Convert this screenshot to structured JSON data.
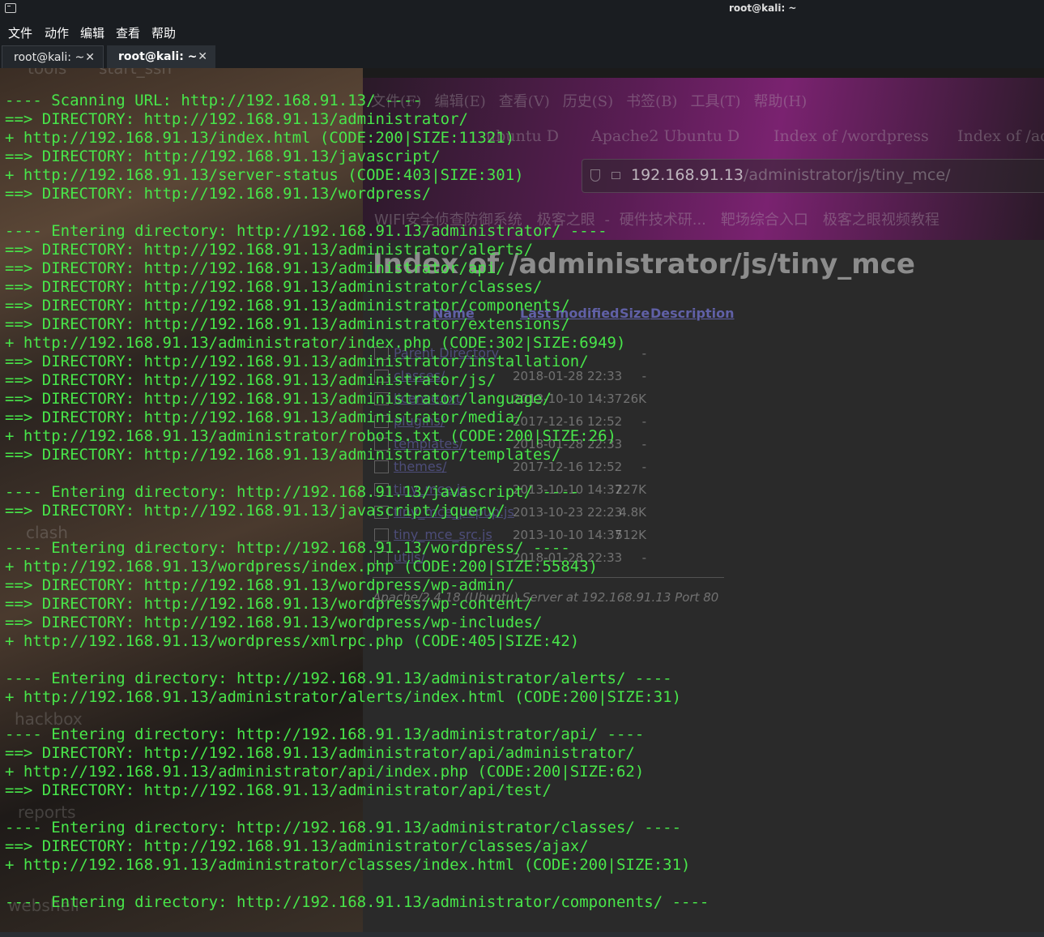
{
  "window": {
    "title": "root@kali: ~"
  },
  "menubar": [
    "文件",
    "动作",
    "编辑",
    "查看",
    "帮助"
  ],
  "tabs": [
    {
      "label": "root@kali: ~",
      "active": false
    },
    {
      "label": "root@kali: ~",
      "active": true
    }
  ],
  "tab_close_glyph": "✕",
  "terminal_lines": [
    "---- Scanning URL: http://192.168.91.13/ ----",
    "==> DIRECTORY: http://192.168.91.13/administrator/",
    "+ http://192.168.91.13/index.html (CODE:200|SIZE:11321)",
    "==> DIRECTORY: http://192.168.91.13/javascript/",
    "+ http://192.168.91.13/server-status (CODE:403|SIZE:301)",
    "==> DIRECTORY: http://192.168.91.13/wordpress/",
    "",
    "---- Entering directory: http://192.168.91.13/administrator/ ----",
    "==> DIRECTORY: http://192.168.91.13/administrator/alerts/",
    "==> DIRECTORY: http://192.168.91.13/administrator/api/",
    "==> DIRECTORY: http://192.168.91.13/administrator/classes/",
    "==> DIRECTORY: http://192.168.91.13/administrator/components/",
    "==> DIRECTORY: http://192.168.91.13/administrator/extensions/",
    "+ http://192.168.91.13/administrator/index.php (CODE:302|SIZE:6949)",
    "==> DIRECTORY: http://192.168.91.13/administrator/installation/",
    "==> DIRECTORY: http://192.168.91.13/administrator/js/",
    "==> DIRECTORY: http://192.168.91.13/administrator/language/",
    "==> DIRECTORY: http://192.168.91.13/administrator/media/",
    "+ http://192.168.91.13/administrator/robots.txt (CODE:200|SIZE:26)",
    "==> DIRECTORY: http://192.168.91.13/administrator/templates/",
    "",
    "---- Entering directory: http://192.168.91.13/javascript/ ----",
    "==> DIRECTORY: http://192.168.91.13/javascript/jquery/",
    "",
    "---- Entering directory: http://192.168.91.13/wordpress/ ----",
    "+ http://192.168.91.13/wordpress/index.php (CODE:200|SIZE:55843)",
    "==> DIRECTORY: http://192.168.91.13/wordpress/wp-admin/",
    "==> DIRECTORY: http://192.168.91.13/wordpress/wp-content/",
    "==> DIRECTORY: http://192.168.91.13/wordpress/wp-includes/",
    "+ http://192.168.91.13/wordpress/xmlrpc.php (CODE:405|SIZE:42)",
    "",
    "---- Entering directory: http://192.168.91.13/administrator/alerts/ ----",
    "+ http://192.168.91.13/administrator/alerts/index.html (CODE:200|SIZE:31)",
    "",
    "---- Entering directory: http://192.168.91.13/administrator/api/ ----",
    "==> DIRECTORY: http://192.168.91.13/administrator/api/administrator/",
    "+ http://192.168.91.13/administrator/api/index.php (CODE:200|SIZE:62)",
    "==> DIRECTORY: http://192.168.91.13/administrator/api/test/",
    "",
    "---- Entering directory: http://192.168.91.13/administrator/classes/ ----",
    "==> DIRECTORY: http://192.168.91.13/administrator/classes/ajax/",
    "+ http://192.168.91.13/administrator/classes/index.html (CODE:200|SIZE:31)",
    "",
    "---- Entering directory: http://192.168.91.13/administrator/components/ ----"
  ],
  "background_browser": {
    "menu": [
      "文件(F)",
      "编辑(E)",
      "查看(V)",
      "历史(S)",
      "书签(B)",
      "工具(T)",
      "帮助(H)"
    ],
    "tabs": [
      "ubuntu D",
      "Apache2 Ubuntu D",
      "Index of /wordpress",
      "Index of /ad"
    ],
    "url_host": "192.168.91.13",
    "url_path": "/administrator/js/tiny_mce/",
    "bookmarks": [
      "WIFI安全侦查防御系统",
      "极客之眼 - 硬件技术研...",
      "靶场综合入口",
      "极客之眼视频教程"
    ],
    "heading": "Index of /administrator/js/tiny_mce",
    "columns": [
      "Name",
      "Last modified",
      "Size",
      "Description"
    ],
    "rows": [
      {
        "name": "Parent Directory",
        "date": "",
        "size": "-"
      },
      {
        "name": "classes/",
        "date": "2018-01-28 22:33",
        "size": "-"
      },
      {
        "name": "license.txt",
        "date": "2013-10-10 14:37",
        "size": "26K"
      },
      {
        "name": "plugins/",
        "date": "2017-12-16 12:52",
        "size": "-"
      },
      {
        "name": "templates/",
        "date": "2018-01-28 22:33",
        "size": "-"
      },
      {
        "name": "themes/",
        "date": "2017-12-16 12:52",
        "size": "-"
      },
      {
        "name": "tiny_mce.js",
        "date": "2013-10-10 14:37",
        "size": "227K"
      },
      {
        "name": "tiny_mce_popup.js",
        "date": "2013-10-23 22:23",
        "size": "4.8K"
      },
      {
        "name": "tiny_mce_src.js",
        "date": "2013-10-10 14:37",
        "size": "512K"
      },
      {
        "name": "utils/",
        "date": "2018-01-28 22:33",
        "size": "-"
      }
    ],
    "footer": "Apache/2.4.18 (Ubuntu) Server at 192.168.91.13 Port 80"
  },
  "desktop_labels": [
    "tools",
    "start_ssh",
    "clash",
    "hackbox",
    "reports",
    "webshell"
  ],
  "colors": {
    "terminal_text": "#48e64a",
    "terminal_bg": "#0d0d0d",
    "chrome_bg": "#1a1d21"
  }
}
